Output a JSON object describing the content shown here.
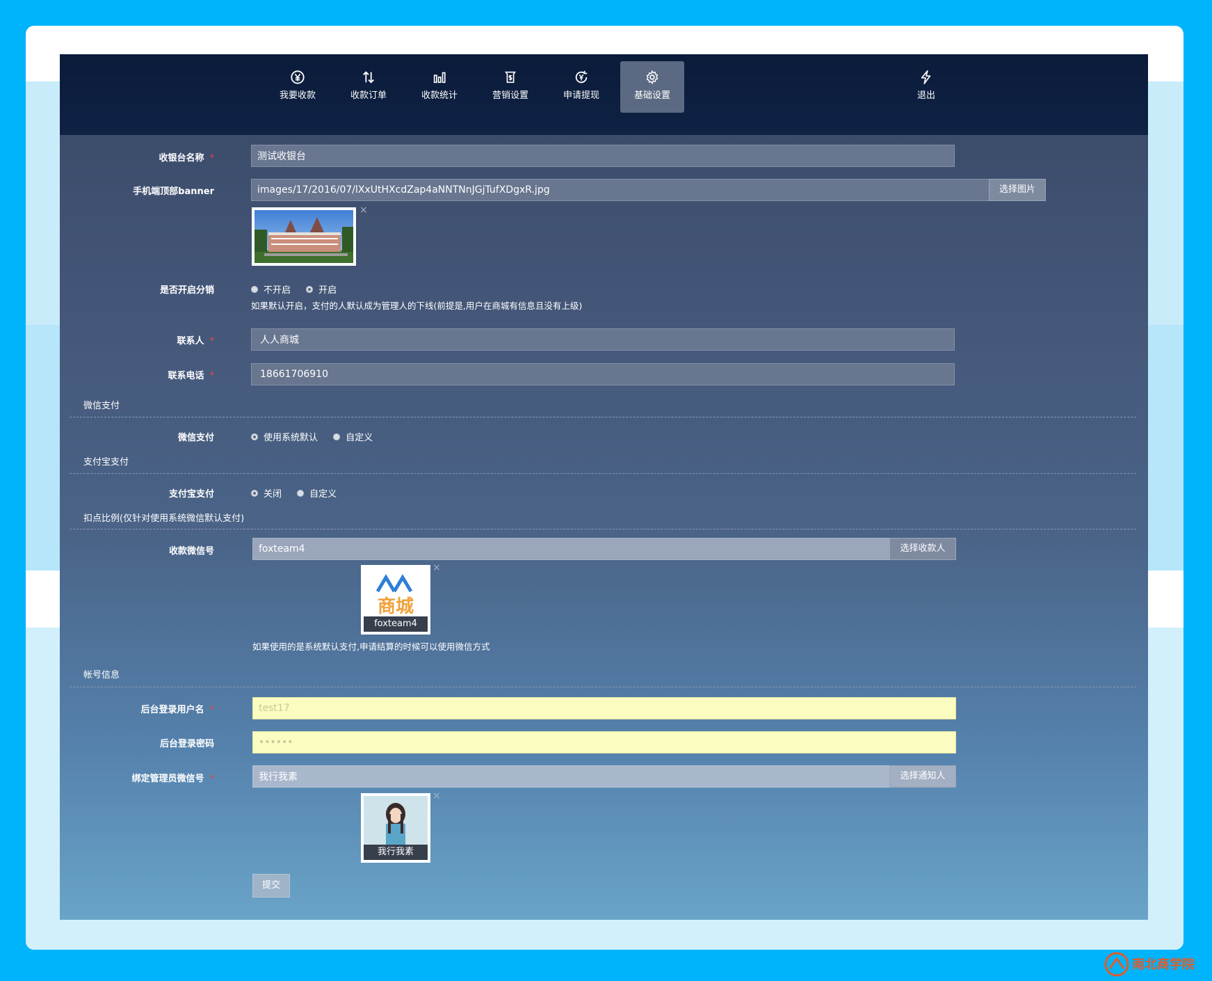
{
  "nav": {
    "items": [
      {
        "label": "我要收款",
        "icon": "yuan-circle-icon"
      },
      {
        "label": "收款订单",
        "icon": "sort-arrows-icon"
      },
      {
        "label": "收款统计",
        "icon": "bar-chart-icon"
      },
      {
        "label": "营销设置",
        "icon": "money-bag-icon"
      },
      {
        "label": "申请提现",
        "icon": "withdraw-circle-icon"
      },
      {
        "label": "基础设置",
        "icon": "gear-icon"
      },
      {
        "label": "退出",
        "icon": "lightning-icon"
      }
    ],
    "active": "基础设置"
  },
  "form": {
    "name_label": "收银台名称",
    "name_value": "测试收银台",
    "banner_label": "手机端顶部banner",
    "banner_value": "images/17/2016/07/lXxUtHXcdZap4aNNTNnJGjTufXDgxR.jpg",
    "banner_button": "选择图片",
    "distribution_label": "是否开启分销",
    "distribution_options": [
      "不开启",
      "开启"
    ],
    "distribution_selected": "开启",
    "distribution_help": "如果默认开启，支付的人默认成为管理人的下线(前提是,用户在商城有信息且没有上级)",
    "contact_label": "联系人",
    "contact_value": "人人商城",
    "phone_label": "联系电话",
    "phone_value": "18661706910",
    "wechat_section": "微信支付",
    "wechat_label": "微信支付",
    "wechat_options": [
      "使用系统默认",
      "自定义"
    ],
    "wechat_selected": "使用系统默认",
    "alipay_section": "支付宝支付",
    "alipay_label": "支付宝支付",
    "alipay_options": [
      "关闭",
      "自定义"
    ],
    "alipay_selected": "关闭",
    "commission_section": "扣点比例(仅针对使用系统微信默认支付)",
    "receiver_label": "收款微信号",
    "receiver_value": "foxteam4",
    "receiver_button": "选择收款人",
    "receiver_caption": "foxteam4",
    "receiver_logo_text": "商城",
    "receiver_help": "如果使用的是系统默认支付,申请结算的时候可以使用微信方式",
    "account_section": "帐号信息",
    "username_label": "后台登录用户名",
    "username_value": "test17",
    "password_label": "后台登录密码",
    "password_value": "••••••",
    "admin_label": "绑定管理员微信号",
    "admin_value": "我行我素",
    "admin_button": "选择通知人",
    "admin_caption": "我行我素",
    "submit": "提交",
    "close_symbol": "×"
  },
  "watermark": {
    "text": "南北商学院"
  }
}
